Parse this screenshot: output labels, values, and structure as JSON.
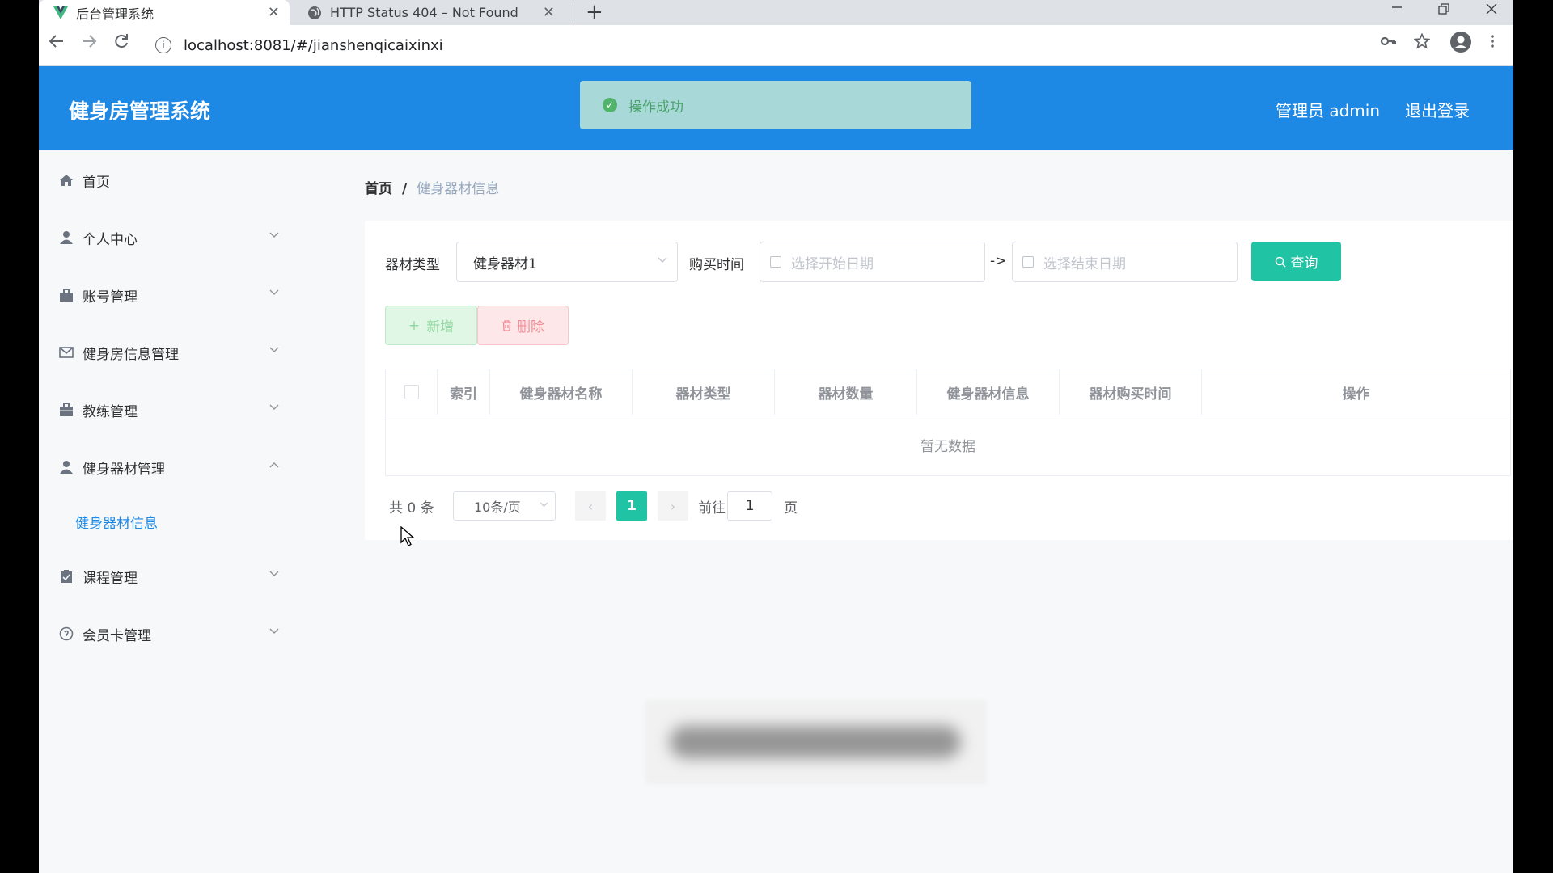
{
  "browser": {
    "tabs": [
      {
        "title": "后台管理系统",
        "icon": "vue-logo-icon",
        "close": "✕"
      },
      {
        "title": "HTTP Status 404 – Not Found",
        "icon": "globe-icon",
        "close": "✕"
      }
    ],
    "new_tab": "+",
    "url": "localhost:8081/#/jianshenqicaixinxi"
  },
  "header": {
    "title": "健身房管理系统",
    "toast": "操作成功",
    "user": "管理员 admin",
    "logout": "退出登录"
  },
  "sidebar": {
    "items": [
      {
        "label": "首页",
        "icon": "home-icon"
      },
      {
        "label": "个人中心",
        "icon": "user-icon"
      },
      {
        "label": "账号管理",
        "icon": "briefcase-icon"
      },
      {
        "label": "健身房信息管理",
        "icon": "mail-icon"
      },
      {
        "label": "教练管理",
        "icon": "suitcase-icon"
      },
      {
        "label": "健身器材管理",
        "icon": "user-icon"
      },
      {
        "label": "课程管理",
        "icon": "clipboard-icon"
      },
      {
        "label": "会员卡管理",
        "icon": "info-circle-icon"
      }
    ],
    "active_sub": "健身器材信息"
  },
  "breadcrumb": {
    "home": "首页",
    "separator": "/",
    "current": "健身器材信息"
  },
  "filters": {
    "type_label": "器材类型",
    "type_value": "健身器材1",
    "time_label": "购买时间",
    "start_placeholder": "选择开始日期",
    "arrow": "->",
    "end_placeholder": "选择结束日期",
    "query_label": "查询"
  },
  "actions": {
    "add": "新增",
    "delete": "删除"
  },
  "table": {
    "columns": [
      "索引",
      "健身器材名称",
      "器材类型",
      "器材数量",
      "健身器材信息",
      "器材购买时间",
      "操作"
    ],
    "empty_text": "暂无数据"
  },
  "pagination": {
    "total": "共 0 条",
    "page_size": "10条/页",
    "current_page": "1",
    "goto_label": "前往",
    "goto_value": "1",
    "page_suffix": "页"
  },
  "colors": {
    "primary": "#1e88e5",
    "accent": "#20c3a3"
  }
}
